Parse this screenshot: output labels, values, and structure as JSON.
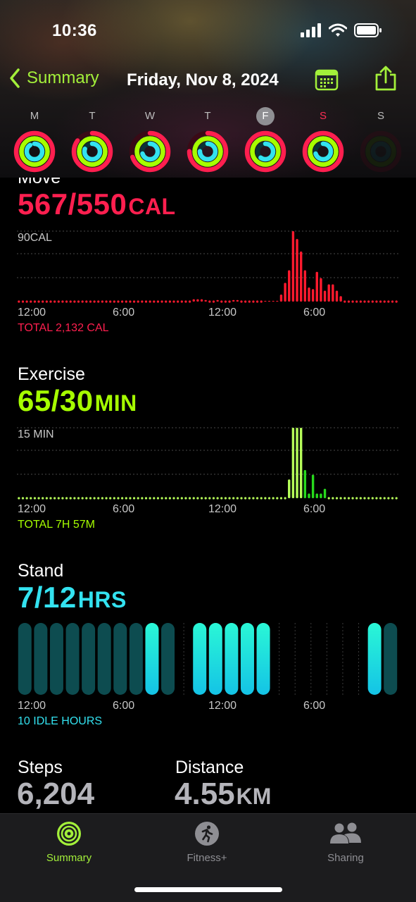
{
  "status": {
    "time": "10:36"
  },
  "nav": {
    "back_label": "Summary",
    "date": "Friday, Nov 8, 2024"
  },
  "week": [
    {
      "letter": "M",
      "move": 1.0,
      "exercise": 1.0,
      "stand": 0.9
    },
    {
      "letter": "T",
      "move": 0.85,
      "exercise": 1.0,
      "stand": 0.8
    },
    {
      "letter": "W",
      "move": 0.7,
      "exercise": 1.0,
      "stand": 0.7
    },
    {
      "letter": "T",
      "move": 0.75,
      "exercise": 1.0,
      "stand": 0.75
    },
    {
      "letter": "F",
      "move": 1.0,
      "exercise": 1.0,
      "stand": 0.6,
      "selected": true
    },
    {
      "letter": "S",
      "move": 1.0,
      "exercise": 1.0,
      "stand": 0.7,
      "weekend": true
    },
    {
      "letter": "S",
      "move": 0,
      "exercise": 0,
      "stand": 0,
      "future": true
    }
  ],
  "move": {
    "title": "Move",
    "value": "567/550",
    "unit": "CAL",
    "scale_label": "90CAL",
    "axis": [
      "12:00",
      "6:00",
      "12:00",
      "6:00"
    ],
    "total": "TOTAL 2,132 CAL",
    "color": "#ff1f4f",
    "bar_color": "#ff1a2e",
    "scale_max": 90,
    "bars": [
      [
        44,
        3
      ],
      [
        45,
        3
      ],
      [
        46,
        3
      ],
      [
        47,
        2
      ],
      [
        50,
        2
      ],
      [
        54,
        2
      ],
      [
        55,
        2
      ],
      [
        62,
        1
      ],
      [
        63,
        1
      ],
      [
        64,
        1
      ],
      [
        65,
        1
      ],
      [
        66,
        9
      ],
      [
        67,
        24
      ],
      [
        68,
        40
      ],
      [
        69,
        90
      ],
      [
        70,
        80
      ],
      [
        71,
        64
      ],
      [
        72,
        40
      ],
      [
        73,
        18
      ],
      [
        74,
        16
      ],
      [
        75,
        38
      ],
      [
        76,
        30
      ],
      [
        77,
        14
      ],
      [
        78,
        22
      ],
      [
        79,
        22
      ],
      [
        80,
        14
      ],
      [
        81,
        7
      ]
    ]
  },
  "exercise": {
    "title": "Exercise",
    "value": "65/30",
    "unit": "MIN",
    "scale_label": "15 MIN",
    "axis": [
      "12:00",
      "6:00",
      "12:00",
      "6:00"
    ],
    "total": "TOTAL 7H 57M",
    "color": "#a6ff00",
    "bar_color": "#b6ff5a",
    "bar_color2": "#27d81c",
    "scale_max": 15,
    "bars": [
      [
        68,
        4
      ],
      [
        69,
        15
      ],
      [
        70,
        15
      ],
      [
        71,
        15
      ],
      [
        72,
        6
      ],
      [
        73,
        1
      ],
      [
        74,
        5
      ],
      [
        75,
        1
      ],
      [
        76,
        1
      ],
      [
        77,
        2
      ]
    ]
  },
  "stand": {
    "title": "Stand",
    "value": "7/12",
    "unit": "HRS",
    "axis": [
      "12:00",
      "6:00",
      "12:00",
      "6:00"
    ],
    "total": "10 IDLE HOURS",
    "color": "#33e2f0",
    "hours": [
      0,
      0,
      0,
      0,
      0,
      0,
      0,
      0,
      1,
      0,
      -1,
      1,
      1,
      1,
      1,
      1,
      -1,
      -1,
      -1,
      -1,
      -1,
      -1,
      1,
      0
    ]
  },
  "steps": {
    "label": "Steps",
    "value": "6,204"
  },
  "distance": {
    "label": "Distance",
    "value": "4.55",
    "unit": "KM"
  },
  "tabs": [
    {
      "label": "Summary",
      "icon": "summary-rings-icon",
      "active": true
    },
    {
      "label": "Fitness+",
      "icon": "fitness-plus-icon"
    },
    {
      "label": "Sharing",
      "icon": "sharing-people-icon"
    }
  ],
  "colors": {
    "accent": "#a3f03a",
    "move": "#ff1f4f",
    "exercise": "#a6ff00",
    "stand": "#33e2f0"
  }
}
